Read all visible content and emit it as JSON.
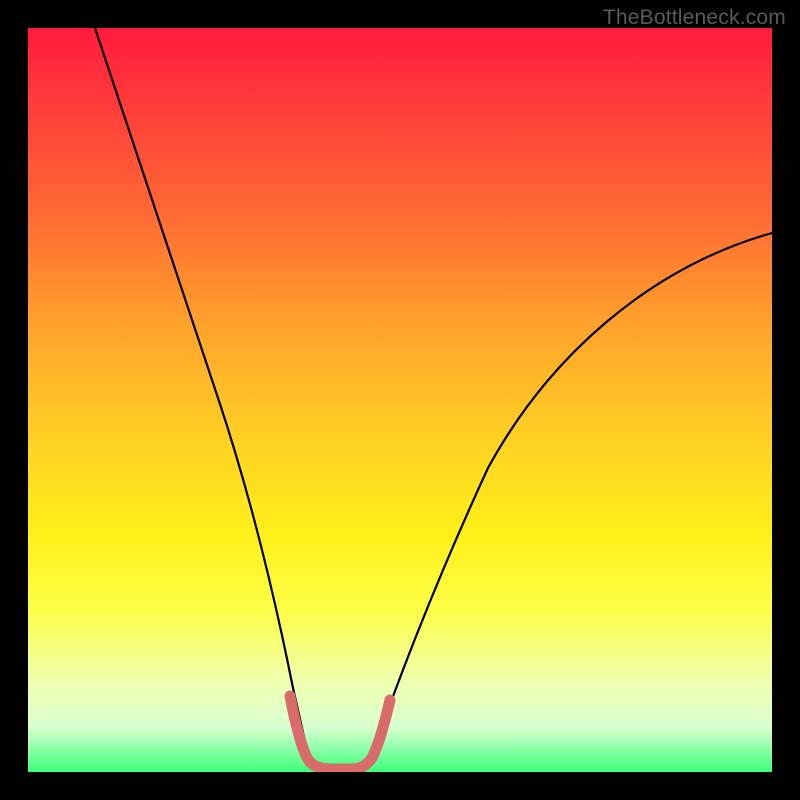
{
  "watermark": "TheBottleneck.com",
  "chart_data": {
    "type": "line",
    "title": "",
    "xlabel": "",
    "ylabel": "",
    "xlim": [
      0,
      100
    ],
    "ylim": [
      0,
      100
    ],
    "series": [
      {
        "name": "curve",
        "x": [
          9,
          12,
          16,
          20,
          24,
          28,
          31,
          33,
          35,
          36,
          37.5,
          39,
          41,
          43,
          45,
          46,
          48,
          52,
          56,
          60,
          66,
          72,
          80,
          90,
          100
        ],
        "y": [
          100,
          90,
          78,
          66,
          54,
          40,
          28,
          18,
          10,
          5,
          2,
          2,
          2,
          2,
          5,
          10,
          16,
          26,
          34,
          42,
          50,
          56,
          62,
          67,
          70
        ]
      }
    ],
    "highlight_segment": {
      "x": [
        35,
        36,
        37.5,
        39,
        41,
        43,
        45,
        46
      ],
      "y": [
        10,
        5,
        2,
        2,
        2,
        2,
        5,
        10
      ],
      "color": "#d96b6b"
    },
    "gradient_stops": [
      {
        "pos": 0,
        "color": "#ff1a3c"
      },
      {
        "pos": 50,
        "color": "#ffd024"
      },
      {
        "pos": 80,
        "color": "#fcff45"
      },
      {
        "pos": 100,
        "color": "#3cff7a"
      }
    ]
  }
}
